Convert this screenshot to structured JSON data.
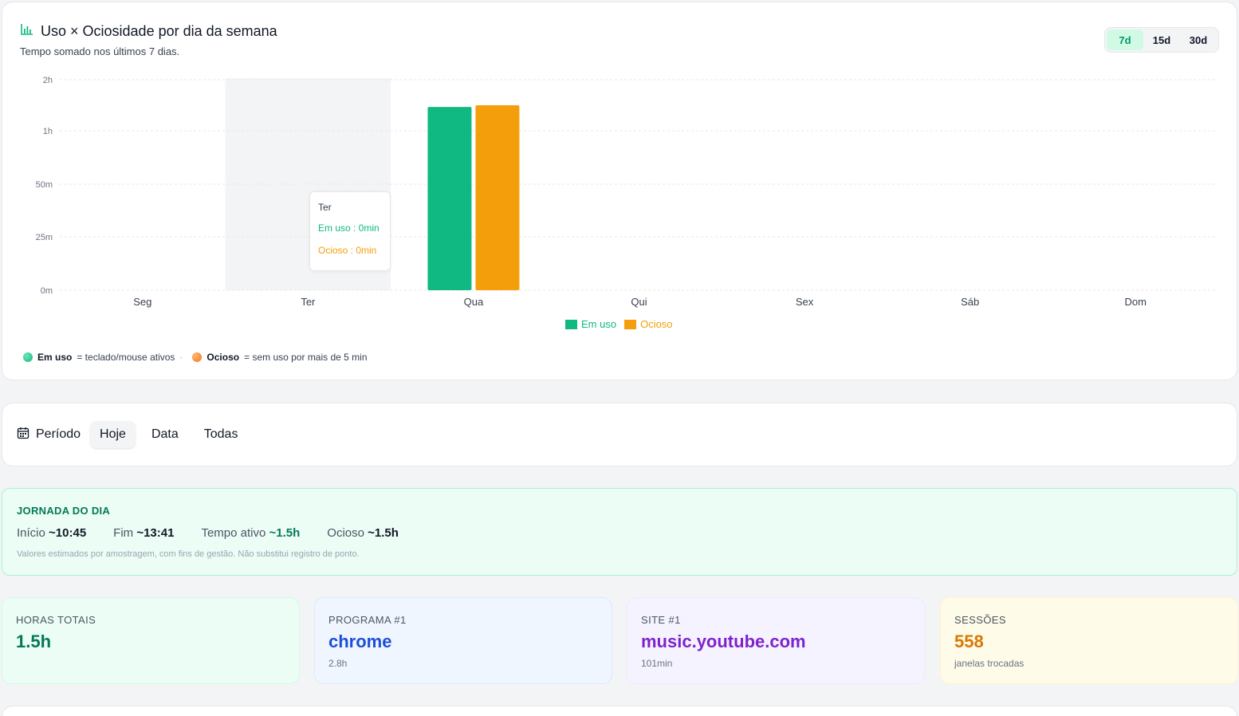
{
  "chart_card": {
    "title": "Uso × Ociosidade por dia da semana",
    "subtitle": "Tempo somado nos últimos 7 dias.",
    "ranges": [
      "7d",
      "15d",
      "30d"
    ],
    "active_range": "7d",
    "tooltip": {
      "day": "Ter",
      "use_label": "Em uso : 0min",
      "idle_label": "Ocioso : 0min"
    },
    "legend": {
      "use": "Em uso",
      "idle": "Ocioso"
    },
    "note": {
      "use_term": "Em uso",
      "use_desc": "= teclado/mouse ativos",
      "sep": "·",
      "idle_term": "Ocioso",
      "idle_desc": "= sem uso por mais de 5 min"
    },
    "colors": {
      "use": "#10b981",
      "idle": "#f59e0b",
      "idle_dot": "#f97316"
    }
  },
  "chart_data": {
    "type": "bar",
    "categories": [
      "Seg",
      "Ter",
      "Qua",
      "Qui",
      "Sex",
      "Sáb",
      "Dom"
    ],
    "series": [
      {
        "name": "Em uso",
        "values": [
          0,
          0,
          88,
          0,
          0,
          0,
          0
        ]
      },
      {
        "name": "Ocioso",
        "values": [
          0,
          0,
          90,
          0,
          0,
          0,
          0
        ]
      }
    ],
    "y_unit": "min",
    "y_ticks": [
      {
        "value": 0,
        "label": "0m"
      },
      {
        "value": 25,
        "label": "25m"
      },
      {
        "value": 50,
        "label": "50m"
      },
      {
        "value": 60,
        "label": "1h"
      },
      {
        "value": 120,
        "label": "2h"
      }
    ],
    "highlighted_category": "Ter",
    "grid": true,
    "legend_position": "bottom-center"
  },
  "filter": {
    "label": "Período",
    "options": [
      "Hoje",
      "Data",
      "Todas"
    ],
    "active": "Hoje"
  },
  "journey": {
    "title": "JORNADA DO DIA",
    "start_label": "Início",
    "start_value": "~10:45",
    "end_label": "Fim",
    "end_value": "~13:41",
    "active_label": "Tempo ativo",
    "active_value": "~1.5h",
    "idle_label": "Ocioso",
    "idle_value": "~1.5h",
    "note": "Valores estimados por amostragem, com fins de gestão. Não substitui registro de ponto."
  },
  "kpis": {
    "hours": {
      "label": "HORAS TOTAIS",
      "value": "1.5h"
    },
    "program": {
      "label": "PROGRAMA #1",
      "value": "chrome",
      "sub": "2.8h"
    },
    "site": {
      "label": "SITE #1",
      "value": "music.youtube.com",
      "sub": "101min"
    },
    "sessions": {
      "label": "SESSÕES",
      "value": "558",
      "sub": "janelas trocadas"
    }
  }
}
